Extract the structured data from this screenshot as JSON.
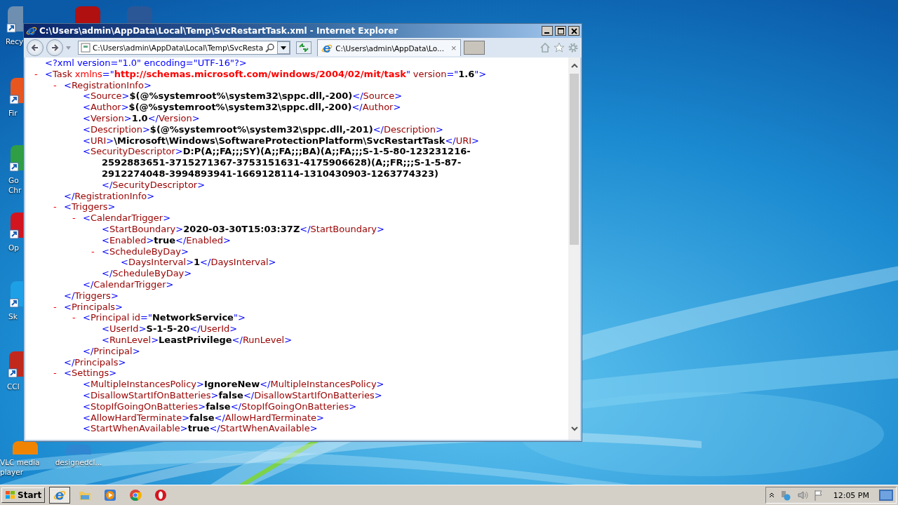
{
  "desktop_icons": [
    {
      "label": "Recy",
      "color": "#6f8fb0"
    },
    {
      "color": "#b01010"
    },
    {
      "color": "#2b5797"
    },
    {
      "label": "Fir",
      "color": "#e8561f"
    },
    {
      "label": "Go Chr",
      "color": "#2f9e44"
    },
    {
      "label": "Op",
      "color": "#d3151f"
    },
    {
      "label": "Sk",
      "color": "#1ea0e6"
    },
    {
      "label": "CCl",
      "color": "#c2291d"
    },
    {
      "label": "VLC media player",
      "color": "#f08400"
    },
    {
      "label": "designedcl...",
      "color": "#2f86d1"
    }
  ],
  "window": {
    "title": "C:\\Users\\admin\\AppData\\Local\\Temp\\SvcRestartTask.xml - Internet Explorer",
    "address": "C:\\Users\\admin\\AppData\\Local\\Temp\\SvcResta",
    "tab": {
      "label": "C:\\Users\\admin\\AppData\\Lo...",
      "close": "×",
      "selected": true
    }
  },
  "xml": {
    "declaration": "<?xml version=\"1.0\" encoding=\"UTF-16\"?>",
    "root": {
      "kind": "parent",
      "toggle": "-",
      "line": [
        {
          "kind": "bracket",
          "text": "<"
        },
        {
          "kind": "tag",
          "text": "Task"
        },
        {
          "kind": "attr_ns",
          "text": "xmlns"
        },
        {
          "kind": "bracket",
          "text": "=\""
        },
        {
          "kind": "value_ns",
          "text": "http://schemas.microsoft.com/windows/2004/02/mit/task"
        },
        {
          "kind": "bracket",
          "text": "\""
        },
        {
          "kind": "attr",
          "text": "version"
        },
        {
          "kind": "bracket",
          "text": "=\""
        },
        {
          "kind": "value",
          "text": "1.6"
        },
        {
          "kind": "bracket",
          "text": "\">"
        }
      ],
      "children": [
        {
          "kind": "parent",
          "toggle": "-",
          "line": [
            {
              "kind": "bracket",
              "text": "<"
            },
            {
              "kind": "tag",
              "text": "RegistrationInfo"
            },
            {
              "kind": "bracket",
              "text": ">"
            }
          ],
          "close": [
            {
              "kind": "bracket",
              "text": "</"
            },
            {
              "kind": "tag",
              "text": "RegistrationInfo"
            },
            {
              "kind": "bracket",
              "text": ">"
            }
          ],
          "children": [
            {
              "kind": "leaf",
              "line": [
                {
                  "kind": "bracket",
                  "text": "<"
                },
                {
                  "kind": "tag",
                  "text": "Source"
                },
                {
                  "kind": "bracket",
                  "text": ">"
                },
                {
                  "kind": "value",
                  "text": "$(@%systemroot%\\system32\\sppc.dll,-200)"
                },
                {
                  "kind": "bracket",
                  "text": "</"
                },
                {
                  "kind": "tag",
                  "text": "Source"
                },
                {
                  "kind": "bracket",
                  "text": ">"
                }
              ]
            },
            {
              "kind": "leaf",
              "line": [
                {
                  "kind": "bracket",
                  "text": "<"
                },
                {
                  "kind": "tag",
                  "text": "Author"
                },
                {
                  "kind": "bracket",
                  "text": ">"
                },
                {
                  "kind": "value",
                  "text": "$(@%systemroot%\\system32\\sppc.dll,-200)"
                },
                {
                  "kind": "bracket",
                  "text": "</"
                },
                {
                  "kind": "tag",
                  "text": "Author"
                },
                {
                  "kind": "bracket",
                  "text": ">"
                }
              ]
            },
            {
              "kind": "leaf",
              "line": [
                {
                  "kind": "bracket",
                  "text": "<"
                },
                {
                  "kind": "tag",
                  "text": "Version"
                },
                {
                  "kind": "bracket",
                  "text": ">"
                },
                {
                  "kind": "value",
                  "text": "1.0"
                },
                {
                  "kind": "bracket",
                  "text": "</"
                },
                {
                  "kind": "tag",
                  "text": "Version"
                },
                {
                  "kind": "bracket",
                  "text": ">"
                }
              ]
            },
            {
              "kind": "leaf",
              "line": [
                {
                  "kind": "bracket",
                  "text": "<"
                },
                {
                  "kind": "tag",
                  "text": "Description"
                },
                {
                  "kind": "bracket",
                  "text": ">"
                },
                {
                  "kind": "value",
                  "text": "$(@%systemroot%\\system32\\sppc.dll,-201)"
                },
                {
                  "kind": "bracket",
                  "text": "</"
                },
                {
                  "kind": "tag",
                  "text": "Description"
                },
                {
                  "kind": "bracket",
                  "text": ">"
                }
              ]
            },
            {
              "kind": "leaf",
              "line": [
                {
                  "kind": "bracket",
                  "text": "<"
                },
                {
                  "kind": "tag",
                  "text": "URI"
                },
                {
                  "kind": "bracket",
                  "text": ">"
                },
                {
                  "kind": "value",
                  "text": "\\Microsoft\\Windows\\SoftwareProtectionPlatform\\SvcRestartTask"
                },
                {
                  "kind": "bracket",
                  "text": "</"
                },
                {
                  "kind": "tag",
                  "text": "URI"
                },
                {
                  "kind": "bracket",
                  "text": ">"
                }
              ]
            },
            {
              "kind": "wrapped",
              "line": [
                {
                  "kind": "bracket",
                  "text": "<"
                },
                {
                  "kind": "tag",
                  "text": "SecurityDescriptor"
                },
                {
                  "kind": "bracket",
                  "text": ">"
                },
                {
                  "kind": "value",
                  "text": "D:P(A;;FA;;;SY)(A;;FA;;;BA)(A;;FA;;;S-1-5-80-123231216-2592883651-3715271367-3753151631-4175906628)(A;;FR;;;S-1-5-87-2912274048-3994893941-1669128114-1310430903-1263774323)"
                }
              ],
              "close": [
                {
                  "kind": "bracket",
                  "text": "</"
                },
                {
                  "kind": "tag",
                  "text": "SecurityDescriptor"
                },
                {
                  "kind": "bracket",
                  "text": ">"
                }
              ]
            }
          ]
        },
        {
          "kind": "parent",
          "toggle": "-",
          "line": [
            {
              "kind": "bracket",
              "text": "<"
            },
            {
              "kind": "tag",
              "text": "Triggers"
            },
            {
              "kind": "bracket",
              "text": ">"
            }
          ],
          "close": [
            {
              "kind": "bracket",
              "text": "</"
            },
            {
              "kind": "tag",
              "text": "Triggers"
            },
            {
              "kind": "bracket",
              "text": ">"
            }
          ],
          "children": [
            {
              "kind": "parent",
              "toggle": "-",
              "line": [
                {
                  "kind": "bracket",
                  "text": "<"
                },
                {
                  "kind": "tag",
                  "text": "CalendarTrigger"
                },
                {
                  "kind": "bracket",
                  "text": ">"
                }
              ],
              "close": [
                {
                  "kind": "bracket",
                  "text": "</"
                },
                {
                  "kind": "tag",
                  "text": "CalendarTrigger"
                },
                {
                  "kind": "bracket",
                  "text": ">"
                }
              ],
              "children": [
                {
                  "kind": "leaf",
                  "line": [
                    {
                      "kind": "bracket",
                      "text": "<"
                    },
                    {
                      "kind": "tag",
                      "text": "StartBoundary"
                    },
                    {
                      "kind": "bracket",
                      "text": ">"
                    },
                    {
                      "kind": "value",
                      "text": "2020-03-30T15:03:37Z"
                    },
                    {
                      "kind": "bracket",
                      "text": "</"
                    },
                    {
                      "kind": "tag",
                      "text": "StartBoundary"
                    },
                    {
                      "kind": "bracket",
                      "text": ">"
                    }
                  ]
                },
                {
                  "kind": "leaf",
                  "line": [
                    {
                      "kind": "bracket",
                      "text": "<"
                    },
                    {
                      "kind": "tag",
                      "text": "Enabled"
                    },
                    {
                      "kind": "bracket",
                      "text": ">"
                    },
                    {
                      "kind": "value",
                      "text": "true"
                    },
                    {
                      "kind": "bracket",
                      "text": "</"
                    },
                    {
                      "kind": "tag",
                      "text": "Enabled"
                    },
                    {
                      "kind": "bracket",
                      "text": ">"
                    }
                  ]
                },
                {
                  "kind": "parent",
                  "toggle": "-",
                  "line": [
                    {
                      "kind": "bracket",
                      "text": "<"
                    },
                    {
                      "kind": "tag",
                      "text": "ScheduleByDay"
                    },
                    {
                      "kind": "bracket",
                      "text": ">"
                    }
                  ],
                  "close": [
                    {
                      "kind": "bracket",
                      "text": "</"
                    },
                    {
                      "kind": "tag",
                      "text": "ScheduleByDay"
                    },
                    {
                      "kind": "bracket",
                      "text": ">"
                    }
                  ],
                  "children": [
                    {
                      "kind": "leaf",
                      "line": [
                        {
                          "kind": "bracket",
                          "text": "<"
                        },
                        {
                          "kind": "tag",
                          "text": "DaysInterval"
                        },
                        {
                          "kind": "bracket",
                          "text": ">"
                        },
                        {
                          "kind": "value",
                          "text": "1"
                        },
                        {
                          "kind": "bracket",
                          "text": "</"
                        },
                        {
                          "kind": "tag",
                          "text": "DaysInterval"
                        },
                        {
                          "kind": "bracket",
                          "text": ">"
                        }
                      ]
                    }
                  ]
                }
              ]
            }
          ]
        },
        {
          "kind": "parent",
          "toggle": "-",
          "line": [
            {
              "kind": "bracket",
              "text": "<"
            },
            {
              "kind": "tag",
              "text": "Principals"
            },
            {
              "kind": "bracket",
              "text": ">"
            }
          ],
          "close": [
            {
              "kind": "bracket",
              "text": "</"
            },
            {
              "kind": "tag",
              "text": "Principals"
            },
            {
              "kind": "bracket",
              "text": ">"
            }
          ],
          "children": [
            {
              "kind": "parent",
              "toggle": "-",
              "line": [
                {
                  "kind": "bracket",
                  "text": "<"
                },
                {
                  "kind": "tag",
                  "text": "Principal"
                },
                {
                  "kind": "attr",
                  "text": "id"
                },
                {
                  "kind": "bracket",
                  "text": "=\""
                },
                {
                  "kind": "value",
                  "text": "NetworkService"
                },
                {
                  "kind": "bracket",
                  "text": "\">"
                }
              ],
              "close": [
                {
                  "kind": "bracket",
                  "text": "</"
                },
                {
                  "kind": "tag",
                  "text": "Principal"
                },
                {
                  "kind": "bracket",
                  "text": ">"
                }
              ],
              "children": [
                {
                  "kind": "leaf",
                  "line": [
                    {
                      "kind": "bracket",
                      "text": "<"
                    },
                    {
                      "kind": "tag",
                      "text": "UserId"
                    },
                    {
                      "kind": "bracket",
                      "text": ">"
                    },
                    {
                      "kind": "value",
                      "text": "S-1-5-20"
                    },
                    {
                      "kind": "bracket",
                      "text": "</"
                    },
                    {
                      "kind": "tag",
                      "text": "UserId"
                    },
                    {
                      "kind": "bracket",
                      "text": ">"
                    }
                  ]
                },
                {
                  "kind": "leaf",
                  "line": [
                    {
                      "kind": "bracket",
                      "text": "<"
                    },
                    {
                      "kind": "tag",
                      "text": "RunLevel"
                    },
                    {
                      "kind": "bracket",
                      "text": ">"
                    },
                    {
                      "kind": "value",
                      "text": "LeastPrivilege"
                    },
                    {
                      "kind": "bracket",
                      "text": "</"
                    },
                    {
                      "kind": "tag",
                      "text": "RunLevel"
                    },
                    {
                      "kind": "bracket",
                      "text": ">"
                    }
                  ]
                }
              ]
            }
          ]
        },
        {
          "kind": "parent",
          "toggle": "-",
          "line": [
            {
              "kind": "bracket",
              "text": "<"
            },
            {
              "kind": "tag",
              "text": "Settings"
            },
            {
              "kind": "bracket",
              "text": ">"
            }
          ],
          "children": [
            {
              "kind": "leaf",
              "line": [
                {
                  "kind": "bracket",
                  "text": "<"
                },
                {
                  "kind": "tag",
                  "text": "MultipleInstancesPolicy"
                },
                {
                  "kind": "bracket",
                  "text": ">"
                },
                {
                  "kind": "value",
                  "text": "IgnoreNew"
                },
                {
                  "kind": "bracket",
                  "text": "</"
                },
                {
                  "kind": "tag",
                  "text": "MultipleInstancesPolicy"
                },
                {
                  "kind": "bracket",
                  "text": ">"
                }
              ]
            },
            {
              "kind": "leaf",
              "line": [
                {
                  "kind": "bracket",
                  "text": "<"
                },
                {
                  "kind": "tag",
                  "text": "DisallowStartIfOnBatteries"
                },
                {
                  "kind": "bracket",
                  "text": ">"
                },
                {
                  "kind": "value",
                  "text": "false"
                },
                {
                  "kind": "bracket",
                  "text": "</"
                },
                {
                  "kind": "tag",
                  "text": "DisallowStartIfOnBatteries"
                },
                {
                  "kind": "bracket",
                  "text": ">"
                }
              ]
            },
            {
              "kind": "leaf",
              "line": [
                {
                  "kind": "bracket",
                  "text": "<"
                },
                {
                  "kind": "tag",
                  "text": "StopIfGoingOnBatteries"
                },
                {
                  "kind": "bracket",
                  "text": ">"
                },
                {
                  "kind": "value",
                  "text": "false"
                },
                {
                  "kind": "bracket",
                  "text": "</"
                },
                {
                  "kind": "tag",
                  "text": "StopIfGoingOnBatteries"
                },
                {
                  "kind": "bracket",
                  "text": ">"
                }
              ]
            },
            {
              "kind": "leaf",
              "line": [
                {
                  "kind": "bracket",
                  "text": "<"
                },
                {
                  "kind": "tag",
                  "text": "AllowHardTerminate"
                },
                {
                  "kind": "bracket",
                  "text": ">"
                },
                {
                  "kind": "value",
                  "text": "false"
                },
                {
                  "kind": "bracket",
                  "text": "</"
                },
                {
                  "kind": "tag",
                  "text": "AllowHardTerminate"
                },
                {
                  "kind": "bracket",
                  "text": ">"
                }
              ]
            },
            {
              "kind": "leaf",
              "line": [
                {
                  "kind": "bracket",
                  "text": "<"
                },
                {
                  "kind": "tag",
                  "text": "StartWhenAvailable"
                },
                {
                  "kind": "bracket",
                  "text": ">"
                },
                {
                  "kind": "value",
                  "text": "true"
                },
                {
                  "kind": "bracket",
                  "text": "</"
                },
                {
                  "kind": "tag",
                  "text": "StartWhenAvailable"
                },
                {
                  "kind": "bracket",
                  "text": ">"
                }
              ]
            }
          ]
        }
      ]
    }
  },
  "taskbar": {
    "start": "Start",
    "apps": [
      {
        "kind": "ie",
        "selected": true
      },
      {
        "kind": "folder",
        "selected": false
      },
      {
        "kind": "media",
        "selected": false
      },
      {
        "kind": "chrome",
        "selected": false
      },
      {
        "kind": "opera",
        "selected": false
      }
    ],
    "clock": "12:05 PM"
  }
}
